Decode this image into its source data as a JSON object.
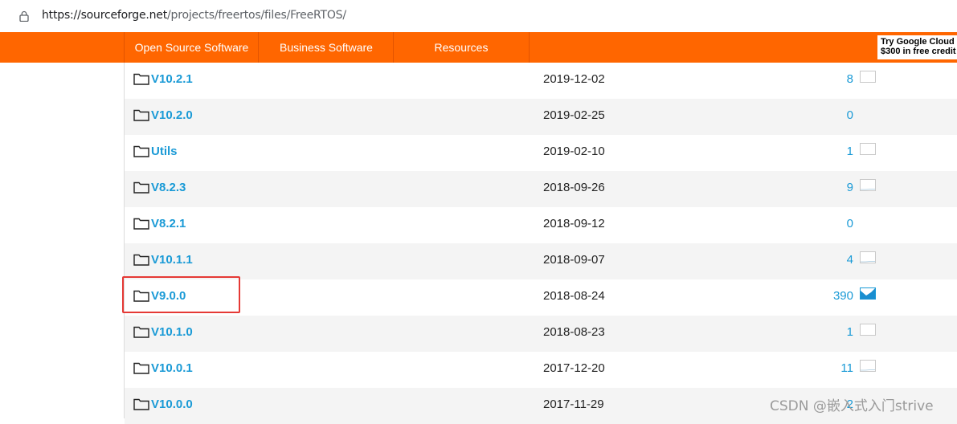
{
  "browser": {
    "url_host": "https://sourceforge.net",
    "url_path": "/projects/freertos/files/FreeRTOS/"
  },
  "nav": {
    "items": [
      {
        "label": "Open Source Software"
      },
      {
        "label": "Business Software"
      },
      {
        "label": "Resources"
      }
    ],
    "ad_line1": "Try Google Cloud",
    "ad_line2": "$300 in free credit"
  },
  "files": [
    {
      "name": "V10.2.1",
      "date": "2019-12-02",
      "downloads": "8",
      "chart": "empty"
    },
    {
      "name": "V10.2.0",
      "date": "2019-02-25",
      "downloads": "0",
      "chart": "none"
    },
    {
      "name": "Utils",
      "date": "2019-02-10",
      "downloads": "1",
      "chart": "empty"
    },
    {
      "name": "V8.2.3",
      "date": "2018-09-26",
      "downloads": "9",
      "chart": "low"
    },
    {
      "name": "V8.2.1",
      "date": "2018-09-12",
      "downloads": "0",
      "chart": "none"
    },
    {
      "name": "V10.1.1",
      "date": "2018-09-07",
      "downloads": "4",
      "chart": "low"
    },
    {
      "name": "V9.0.0",
      "date": "2018-08-24",
      "downloads": "390",
      "chart": "full"
    },
    {
      "name": "V10.1.0",
      "date": "2018-08-23",
      "downloads": "1",
      "chart": "empty"
    },
    {
      "name": "V10.0.1",
      "date": "2017-12-20",
      "downloads": "11",
      "chart": "low"
    },
    {
      "name": "V10.0.0",
      "date": "2017-11-29",
      "downloads": "2",
      "chart": "none"
    }
  ],
  "watermark": "CSDN @嵌入式入门strive",
  "colors": {
    "nav_bg": "#ff6600",
    "link": "#1a9ad6",
    "highlight": "#e53935"
  }
}
